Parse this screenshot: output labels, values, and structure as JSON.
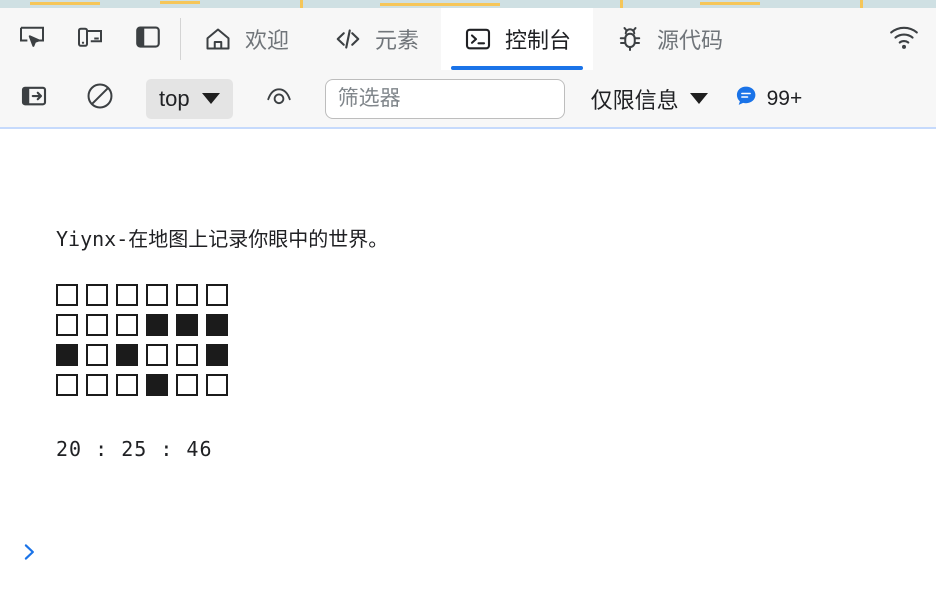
{
  "window": {
    "app": "DevTools",
    "background": "#ffffff",
    "accent": "#1a73e8"
  },
  "page_sliver": {
    "name": "map-page-edge",
    "background": "#cfe0e3",
    "road_color": "#f6c659"
  },
  "tool_buttons": [
    {
      "icon": "inspect-element-icon",
      "title": "检查元素"
    },
    {
      "icon": "device-toolbar-icon",
      "title": "设备工具栏"
    },
    {
      "icon": "dock-side-icon",
      "title": "停靠位置"
    }
  ],
  "tabs": [
    {
      "id": "welcome",
      "label": "欢迎",
      "icon": "home-icon",
      "active": false
    },
    {
      "id": "elements",
      "label": "元素",
      "icon": "code-icon",
      "active": false
    },
    {
      "id": "console",
      "label": "控制台",
      "icon": "terminal-icon",
      "active": true
    },
    {
      "id": "sources",
      "label": "源代码",
      "icon": "bug-icon",
      "active": false
    }
  ],
  "tabstrip_right": {
    "icon": "network-wifi-icon",
    "label": "网络状态"
  },
  "toolbar": {
    "sidebar_toggle": {
      "icon": "console-sidebar-icon",
      "title": "控制台边栏"
    },
    "clear_console": {
      "icon": "clear-console-icon",
      "title": "清空控制台"
    },
    "context": {
      "value": "top",
      "caret": "chevron-down-icon"
    },
    "eye": {
      "icon": "live-expression-icon",
      "title": "实时表达式"
    },
    "filter": {
      "placeholder": "筛选器",
      "value": ""
    },
    "level": {
      "value": "仅限信息",
      "caret": "chevron-down-icon"
    },
    "messages": {
      "icon": "message-bubble-icon",
      "count": "99+",
      "color": "#1a73e8"
    }
  },
  "console": {
    "entries": [
      {
        "type": "text",
        "name": "console-log-message",
        "text": "Yiynx-在地图上记录你眼中的世界。"
      },
      {
        "type": "grid",
        "name": "console-pixel-grid",
        "rows": 4,
        "cols": 6,
        "fill_color": "#1b1b1b",
        "empty_color": "#ffffff",
        "matrix": [
          [
            0,
            0,
            0,
            0,
            0,
            0
          ],
          [
            0,
            0,
            0,
            1,
            1,
            1
          ],
          [
            1,
            0,
            1,
            0,
            0,
            1
          ],
          [
            0,
            0,
            0,
            1,
            0,
            0
          ]
        ]
      },
      {
        "type": "text",
        "name": "console-time-message",
        "text": "20 : 25 : 46"
      }
    ],
    "prompt": {
      "icon": "chevron-right-icon",
      "value": ""
    }
  }
}
